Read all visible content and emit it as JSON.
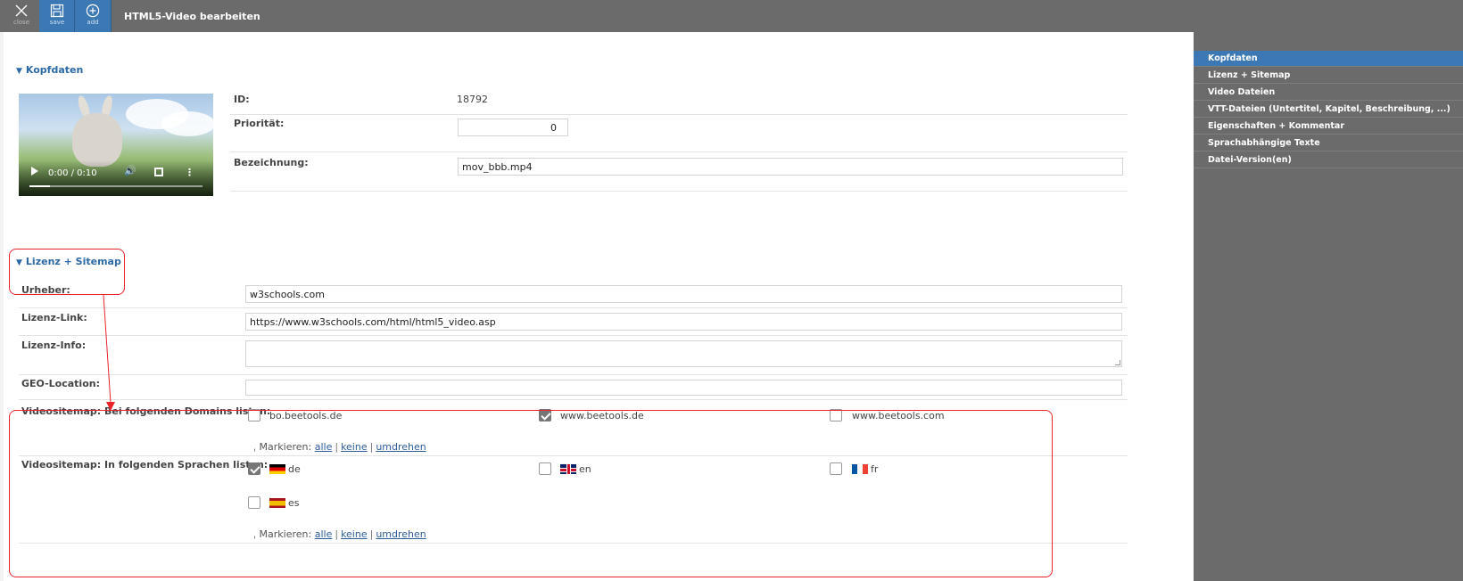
{
  "toolbar": {
    "close_label": "close",
    "save_label": "save",
    "add_label": "add",
    "title": "HTML5-Video bearbeiten"
  },
  "kopfdaten": {
    "heading": "Kopfdaten",
    "video": {
      "time": "0:00 / 0:10",
      "progress": 0.12
    },
    "id_label": "ID:",
    "id_value": "18792",
    "prio_label": "Priorität:",
    "prio_value": "0",
    "bez_label": "Bezeichnung:",
    "bez_value": "mov_bbb.mp4"
  },
  "lizenz": {
    "heading": "Lizenz + Sitemap",
    "urheber_label": "Urheber:",
    "urheber_value": "w3schools.com",
    "link_label": "Lizenz-Link:",
    "link_value": "https://www.w3schools.com/html/html5_video.asp",
    "info_label": "Lizenz-Info:",
    "geo_label": "GEO-Location:",
    "domains_label": "Videositemap: Bei folgenden Domains listen:",
    "domains": [
      {
        "name": "bo.beetools.de",
        "checked": false
      },
      {
        "name": "www.beetools.de",
        "checked": true
      },
      {
        "name": "www.beetools.com",
        "checked": false
      }
    ],
    "sprachen_label": "Videositemap: In folgenden Sprachen listen:",
    "sprachen": [
      {
        "code": "de",
        "checked": true
      },
      {
        "code": "en",
        "checked": false
      },
      {
        "code": "fr",
        "checked": false
      },
      {
        "code": "es",
        "checked": false
      }
    ],
    "mark": {
      "prefix": "Markieren:",
      "all": "alle",
      "none": "keine",
      "invert": "umdrehen",
      "sep": "|"
    }
  },
  "sidebar": {
    "items": [
      {
        "label": "Kopfdaten",
        "active": true
      },
      {
        "label": "Lizenz + Sitemap"
      },
      {
        "label": "Video Dateien"
      },
      {
        "label": "VTT-Dateien (Untertitel, Kapitel, Beschreibung, ...)"
      },
      {
        "label": "Eigenschaften + Kommentar"
      },
      {
        "label": "Sprachabhängige Texte"
      },
      {
        "label": "Datei-Version(en)"
      }
    ]
  },
  "colors": {
    "accent": "#3c79b4",
    "annotation": "#e8232a",
    "background": "#6b6b6b"
  },
  "icons": {
    "close": "close-icon",
    "save": "floppy-icon",
    "add": "plus-circle-icon"
  }
}
